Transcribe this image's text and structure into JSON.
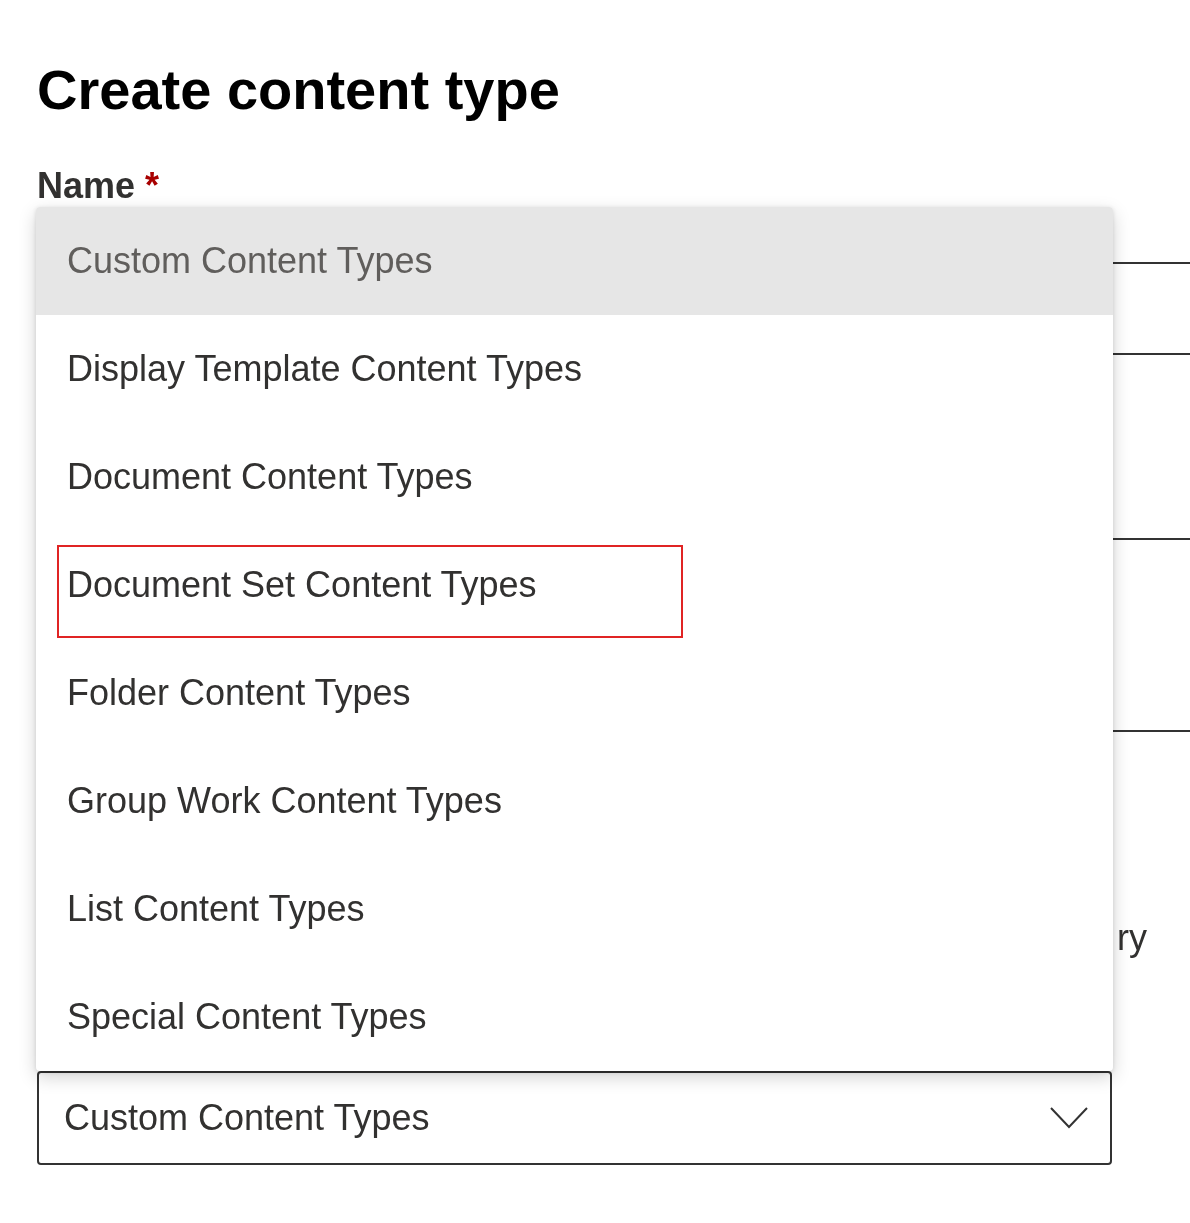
{
  "page": {
    "title": "Create content type"
  },
  "form": {
    "name_label": "Name",
    "required_mark": "*",
    "cut_text": "ry"
  },
  "dropdown": {
    "value": "Custom Content Types",
    "expanded": true,
    "options": [
      {
        "label": "Custom Content Types",
        "selected": true,
        "highlighted": false
      },
      {
        "label": "Display Template Content Types",
        "selected": false,
        "highlighted": false
      },
      {
        "label": "Document Content Types",
        "selected": false,
        "highlighted": false
      },
      {
        "label": "Document Set Content Types",
        "selected": false,
        "highlighted": true
      },
      {
        "label": "Folder Content Types",
        "selected": false,
        "highlighted": false
      },
      {
        "label": "Group Work Content Types",
        "selected": false,
        "highlighted": false
      },
      {
        "label": "List Content Types",
        "selected": false,
        "highlighted": false
      },
      {
        "label": "Special Content Types",
        "selected": false,
        "highlighted": false
      }
    ]
  }
}
